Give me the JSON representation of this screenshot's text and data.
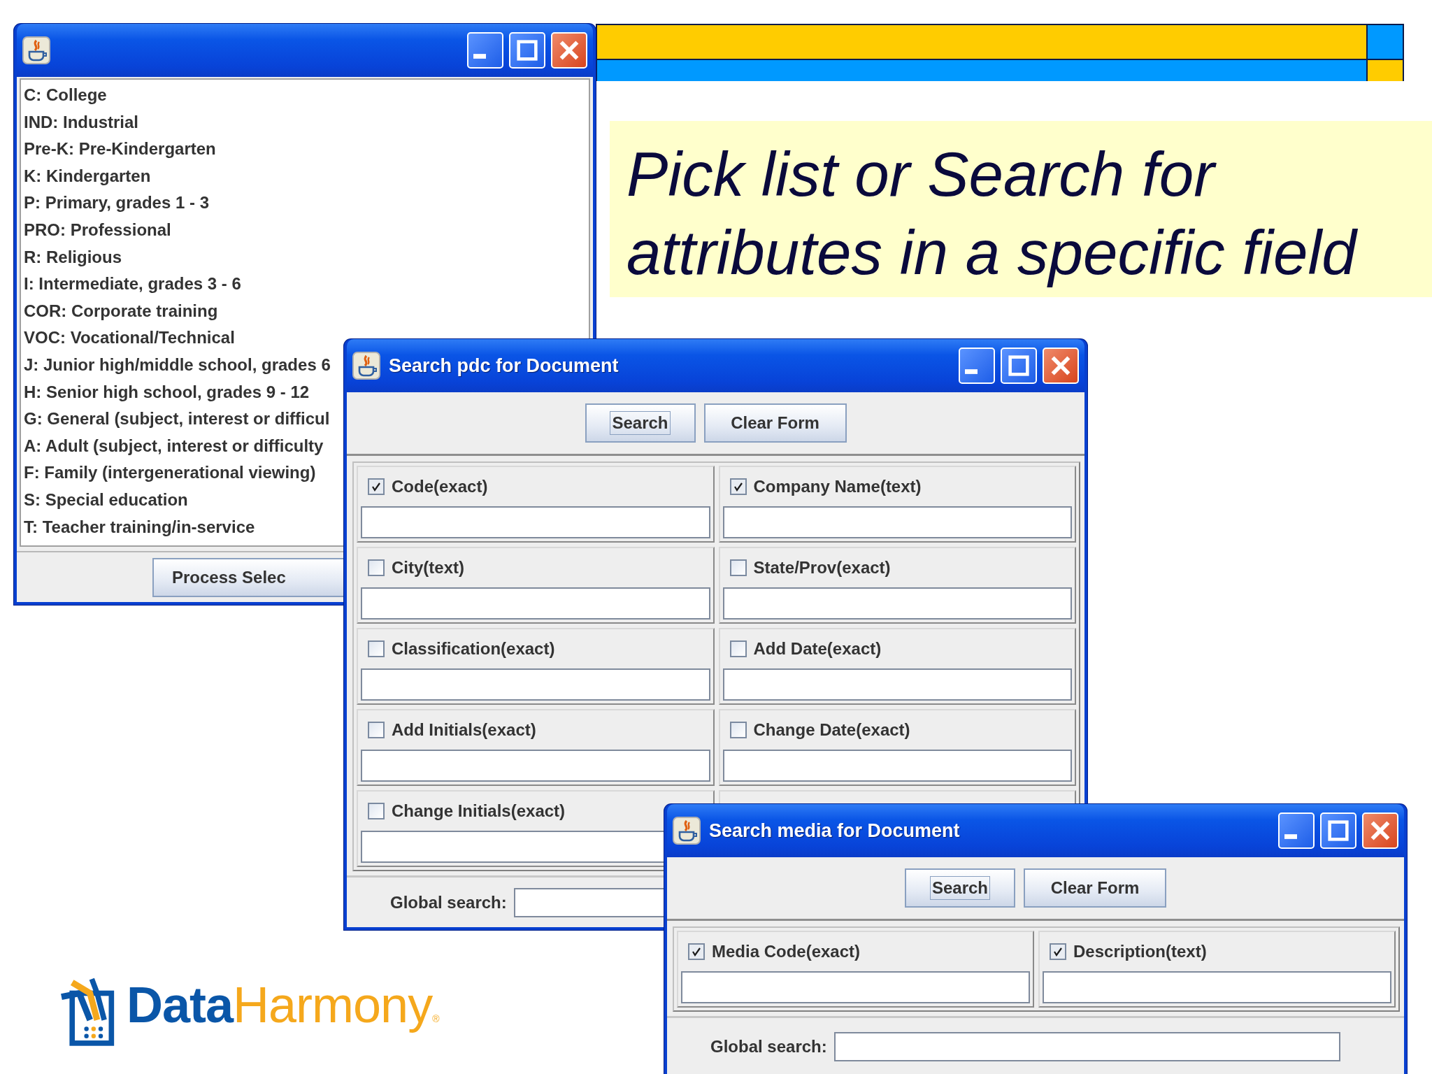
{
  "note": {
    "lines": [
      "Pick list or Search for",
      "attributes in a specific field"
    ]
  },
  "pick_list_window": {
    "items": [
      "C: College",
      "IND: Industrial",
      "Pre-K: Pre-Kindergarten",
      "K: Kindergarten",
      "P: Primary, grades 1 - 3",
      "PRO: Professional",
      "R: Religious",
      "I: Intermediate, grades 3 - 6",
      "COR: Corporate training",
      "VOC: Vocational/Technical",
      "J: Junior high/middle school, grades 6",
      "H: Senior high school, grades 9 - 12",
      "G: General (subject, interest or difficul",
      "A: Adult (subject, interest or difficulty",
      "F: Family (intergenerational viewing)",
      "S: Special education",
      "T: Teacher training/in-service"
    ],
    "button": "Process Selec"
  },
  "pdc_window": {
    "title": "Search pdc for Document",
    "buttons": [
      {
        "label": "Search",
        "focused": true
      },
      {
        "label": "Clear Form",
        "focused": false
      }
    ],
    "fields": [
      {
        "label": "Code(exact)",
        "checked": true
      },
      {
        "label": "Company Name(text)",
        "checked": true
      },
      {
        "label": "City(text)",
        "checked": false
      },
      {
        "label": "State/Prov(exact)",
        "checked": false
      },
      {
        "label": "Classification(exact)",
        "checked": false
      },
      {
        "label": "Add Date(exact)",
        "checked": false
      },
      {
        "label": "Add Initials(exact)",
        "checked": false
      },
      {
        "label": "Change Date(exact)",
        "checked": false
      },
      {
        "label": "Change Initials(exact)",
        "checked": false
      }
    ],
    "global_search_label": "Global search:"
  },
  "media_window": {
    "title": "Search media for Document",
    "buttons": [
      {
        "label": "Search",
        "focused": true
      },
      {
        "label": "Clear Form",
        "focused": false
      }
    ],
    "fields": [
      {
        "label": "Media Code(exact)",
        "checked": true
      },
      {
        "label": "Description(text)",
        "checked": true
      }
    ],
    "global_search_label": "Global search:"
  },
  "logo": {
    "first": "Data",
    "second": "Harmony",
    "mark": "®"
  }
}
